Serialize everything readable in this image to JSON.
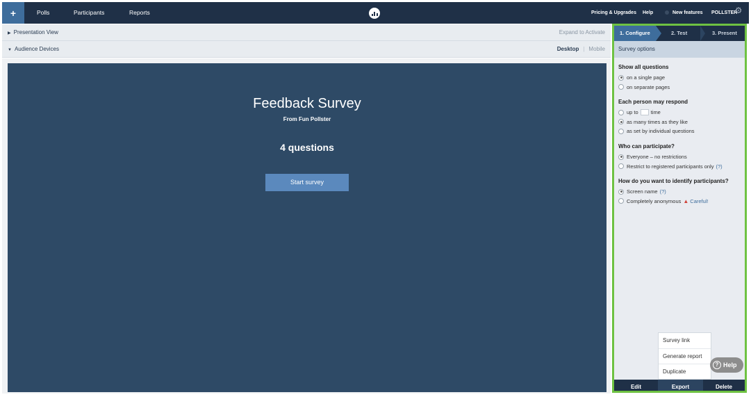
{
  "nav": {
    "add_label": "+",
    "links": [
      "Polls",
      "Participants",
      "Reports"
    ],
    "right": {
      "pricing": "Pricing & Upgrades",
      "help": "Help",
      "new_features": "New features",
      "account": "POLLSTER"
    },
    "icons": {
      "logo": "poll-everywhere-logo-icon",
      "settings": "gear-icon"
    }
  },
  "left": {
    "presentation_view": "Presentation View",
    "expand_to_activate": "Expand to Activate",
    "audience_devices": "Audience Devices",
    "device_desktop": "Desktop",
    "device_mobile": "Mobile",
    "survey": {
      "title": "Feedback Survey",
      "subtitle": "From Fun Pollster",
      "count": "4 questions",
      "start_button": "Start survey"
    }
  },
  "right": {
    "steps": [
      "1. Configure",
      "2. Test",
      "3. Present"
    ],
    "active_step": 0,
    "options_header": "Survey options",
    "sections": [
      {
        "heading": "Show all questions",
        "options": [
          {
            "label": "on a single page",
            "selected": true
          },
          {
            "label": "on separate pages",
            "selected": false
          }
        ]
      },
      {
        "heading": "Each person may respond",
        "options": [
          {
            "label_before": "up to",
            "label_after": "time",
            "selected": false
          },
          {
            "label": "as many times as they like",
            "selected": true
          },
          {
            "label": "as set by individual questions",
            "selected": false
          }
        ]
      },
      {
        "heading": "Who can participate?",
        "options": [
          {
            "label": "Everyone – no restrictions",
            "selected": true
          },
          {
            "label": "Restrict to registered participants only",
            "help": "(?)",
            "selected": false
          }
        ]
      },
      {
        "heading": "How do you want to identify participants?",
        "options": [
          {
            "label": "Screen name",
            "help": "(?)",
            "selected": true
          },
          {
            "label": "Completely anonymous",
            "warning": "Careful!",
            "selected": false
          }
        ]
      }
    ],
    "export_menu": [
      "Survey link",
      "Generate report",
      "Duplicate"
    ],
    "footer": [
      "Edit",
      "Export",
      "Delete"
    ],
    "help_button": "Help"
  },
  "colors": {
    "nav_bg": "#1f3047",
    "accent": "#3e6d9c",
    "canvas_bg": "#2e4a66",
    "start_button": "#5b89bd",
    "highlight_border": "#6ec242"
  }
}
